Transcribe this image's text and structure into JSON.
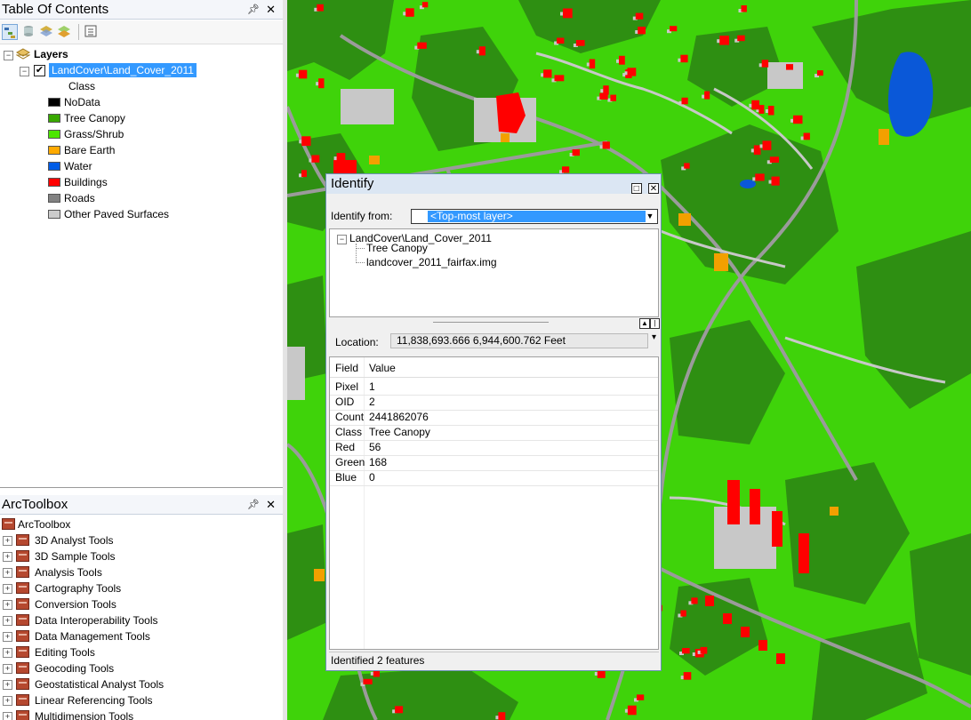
{
  "toc": {
    "title": "Table Of Contents",
    "layers_label": "Layers",
    "layer_name": "LandCover\\Land_Cover_2011",
    "class_header": "Class",
    "legend": [
      {
        "label": "NoData",
        "color": "#000000"
      },
      {
        "label": "Tree Canopy",
        "color": "#38a800"
      },
      {
        "label": "Grass/Shrub",
        "color": "#4ce600"
      },
      {
        "label": "Bare Earth",
        "color": "#ffaa00"
      },
      {
        "label": "Water",
        "color": "#005ce6"
      },
      {
        "label": "Buildings",
        "color": "#ff0000"
      },
      {
        "label": "Roads",
        "color": "#828282"
      },
      {
        "label": "Other Paved Surfaces",
        "color": "#cccccc"
      }
    ]
  },
  "arctoolbox": {
    "title": "ArcToolbox",
    "root": "ArcToolbox",
    "items": [
      "3D Analyst Tools",
      "3D Sample Tools",
      "Analysis Tools",
      "Cartography Tools",
      "Conversion Tools",
      "Data Interoperability Tools",
      "Data Management Tools",
      "Editing Tools",
      "Geocoding Tools",
      "Geostatistical Analyst Tools",
      "Linear Referencing Tools",
      "Multidimension Tools"
    ]
  },
  "identify": {
    "title": "Identify",
    "from_label": "Identify from:",
    "from_value": "<Top-most layer>",
    "tree": {
      "layer": "LandCover\\Land_Cover_2011",
      "feature": "Tree Canopy",
      "source": "landcover_2011_fairfax.img"
    },
    "location_label": "Location:",
    "location_value": "11,838,693.666  6,944,600.762 Feet",
    "headers": {
      "field": "Field",
      "value": "Value"
    },
    "rows": [
      {
        "field": "Pixel",
        "value": "1"
      },
      {
        "field": "OID",
        "value": "2"
      },
      {
        "field": "Count",
        "value": "2441862076"
      },
      {
        "field": "Class",
        "value": "Tree Canopy"
      },
      {
        "field": "Red",
        "value": "56"
      },
      {
        "field": "Green",
        "value": "168"
      },
      {
        "field": "Blue",
        "value": "0"
      }
    ],
    "status": "Identified 2 features"
  },
  "map": {
    "colors": {
      "grass": "#3fd30a",
      "tree": "#2e8f12",
      "road": "#9b9b9b",
      "paved": "#c8c8c8",
      "building": "#ff0000",
      "water": "#0a58d8",
      "bare": "#f2a000"
    }
  }
}
